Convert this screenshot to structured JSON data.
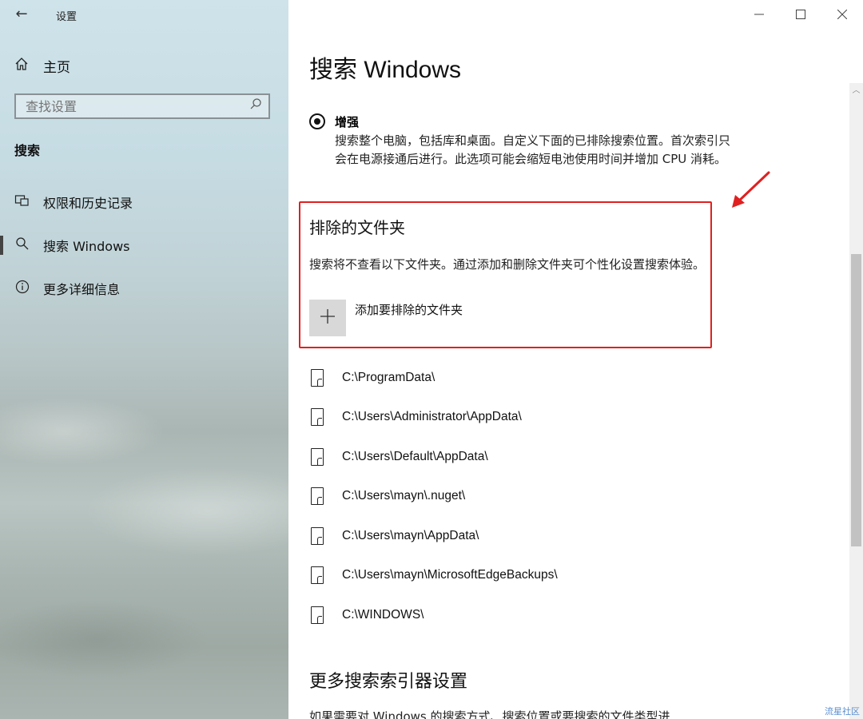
{
  "window": {
    "title": "设置",
    "back_icon": "arrow-left-icon",
    "controls": {
      "minimize": "—",
      "maximize": "☐",
      "close": "✕"
    }
  },
  "sidebar": {
    "home_label": "主页",
    "search_placeholder": "查找设置",
    "section_heading": "搜索",
    "items": [
      {
        "label": "权限和历史记录",
        "icon": "permissions-icon",
        "selected": false
      },
      {
        "label": "搜索 Windows",
        "icon": "search-icon",
        "selected": true
      },
      {
        "label": "更多详细信息",
        "icon": "info-icon",
        "selected": false
      }
    ]
  },
  "main": {
    "title": "搜索 Windows",
    "enhanced": {
      "label": "增强",
      "selected": true,
      "description": "搜索整个电脑，包括库和桌面。自定义下面的已排除搜索位置。首次索引只会在电源接通后进行。此选项可能会缩短电池使用时间并增加 CPU 消耗。"
    },
    "excluded": {
      "title": "排除的文件夹",
      "description": "搜索将不查看以下文件夹。通过添加和删除文件夹可个性化设置搜索体验。",
      "add_label": "添加要排除的文件夹",
      "folders": [
        "C:\\ProgramData\\",
        "C:\\Users\\Administrator\\AppData\\",
        "C:\\Users\\Default\\AppData\\",
        "C:\\Users\\mayn\\.nuget\\",
        "C:\\Users\\mayn\\AppData\\",
        "C:\\Users\\mayn\\MicrosoftEdgeBackups\\",
        "C:\\WINDOWS\\"
      ]
    },
    "more": {
      "title": "更多搜索索引器设置",
      "description": "如果需要对 Windows 的搜索方式、搜索位置或要搜索的文件类型进"
    }
  },
  "colors": {
    "highlight": "#e02020",
    "arrow": "#e02020"
  },
  "watermark": "流星社区"
}
